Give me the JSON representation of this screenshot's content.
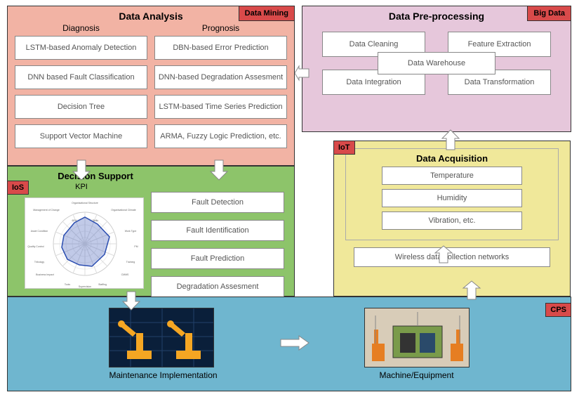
{
  "analysis": {
    "title": "Data Analysis",
    "badge": "Data Mining",
    "diagnosis_label": "Diagnosis",
    "prognosis_label": "Prognosis",
    "diagnosis": [
      "LSTM-based Anomaly Detection",
      "DNN based Fault Classification",
      "Decision Tree",
      "Support Vector Machine"
    ],
    "prognosis": [
      "DBN-based Error Prediction",
      "DNN-based Degradation Assesment",
      "LSTM-based Time Series Prediction",
      "ARMA, Fuzzy Logic Prediction, etc."
    ]
  },
  "preproc": {
    "title": "Data Pre-processing",
    "badge": "Big Data",
    "cells": [
      "Data Cleaning",
      "Feature Extraction",
      "Data Integration",
      "Data Transformation"
    ],
    "center": "Data Warehouse"
  },
  "decision": {
    "title": "Decision Support",
    "badge": "IoS",
    "kpi_label": "KPI",
    "items": [
      "Fault Detection",
      "Fault Identification",
      "Fault Prediction",
      "Degradation Assesment"
    ],
    "radar_labels": [
      "Organisational Structure",
      "Management of Change",
      "Organisational Climate",
      "Skills",
      "Asset Condition",
      "Training",
      "Work Type",
      "Quality Control",
      "PM",
      "Tribology",
      "Planning",
      "Business Impact",
      "CMMS",
      "Supervision",
      "Tools",
      "Staffing",
      "R&M"
    ]
  },
  "acquisition": {
    "title": "Data Acquisition",
    "badge": "IoT",
    "sensors": [
      "Temperature",
      "Humidity",
      "Vibration, etc."
    ],
    "network": "Wireless data collection networks"
  },
  "cps": {
    "badge": "CPS",
    "maintenance": "Maintenance Implementation",
    "machine": "Machine/Equipment"
  }
}
